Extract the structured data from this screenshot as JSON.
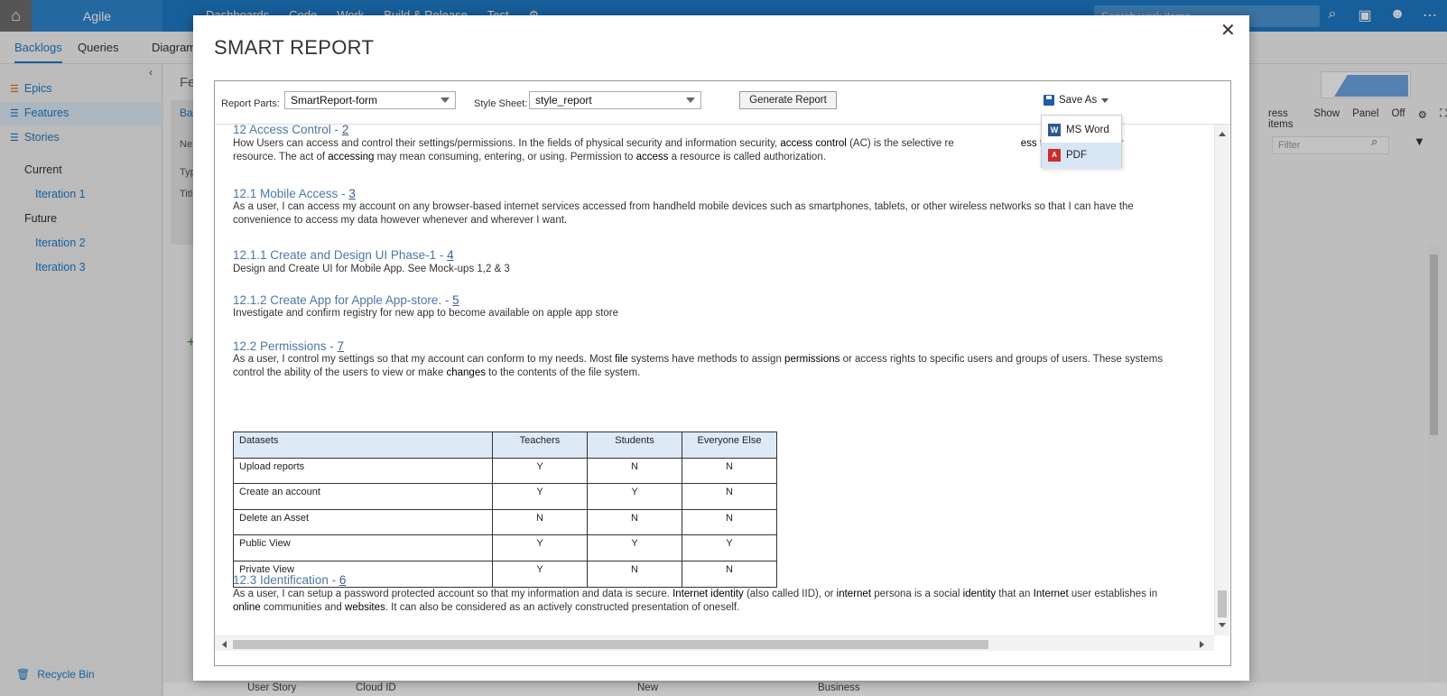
{
  "app": {
    "project": "Agile",
    "hubs": [
      "Dashboards",
      "Code",
      "Work",
      "Build & Release",
      "Test"
    ],
    "search_placeholder": "Search work items",
    "subtabs": [
      "Backlogs",
      "Queries",
      "Diagram"
    ],
    "left_nav": {
      "backlogs": [
        "Epics",
        "Features",
        "Stories"
      ],
      "current_label": "Current",
      "current_iterations": [
        "Iteration 1"
      ],
      "future_label": "Future",
      "future_iterations": [
        "Iteration 2",
        "Iteration 3"
      ],
      "recycle_bin": "Recycle Bin"
    },
    "right_panel": {
      "progress_items": "ress items",
      "show": "Show",
      "panel": "Panel",
      "off": "Off",
      "filter_placeholder": "Filter"
    },
    "bottom_row": {
      "type": "User Story",
      "title": "Cloud ID",
      "state": "New",
      "area": "Business"
    },
    "background_fragments": {
      "main_header": "Fe",
      "tab": "Bac",
      "new": "Ne",
      "type": "Typ",
      "title": "Titl"
    }
  },
  "modal": {
    "title": "SMART REPORT",
    "close_glyph": "✕",
    "toolbar": {
      "report_parts_label": "Report Parts:",
      "report_parts_value": "SmartReport-form",
      "style_sheet_label": "Style Sheet:",
      "style_sheet_value": "style_report",
      "generate_label": "Generate Report",
      "save_as_label": "Save As"
    },
    "save_menu": [
      {
        "label": "MS Word",
        "icon": "word-icon"
      },
      {
        "label": "PDF",
        "icon": "pdf-icon"
      }
    ],
    "sections": [
      {
        "heading": "12 Access Control - ",
        "num": "2",
        "body_parts": [
          "How Users can access and control their settings/permissions. In the fields of physical security and information security, ",
          "access control",
          " (AC) is the selective re",
          "ess",
          " to a place or other resource. The act of ",
          "accessing",
          " may mean consuming, entering, or using. Permission to ",
          "access",
          " a resource is called authorization."
        ]
      },
      {
        "heading": "12.1 Mobile Access - ",
        "num": "3",
        "body": "As a user, I can access my account on any browser-based internet services accessed from handheld mobile devices such as smartphones, tablets, or other wireless networks so that I can have the convenience to access my data however whenever and wherever I want."
      },
      {
        "heading": "12.1.1 Create and Design UI Phase-1 - ",
        "num": "4",
        "body": "Design and Create UI for Mobile App. See Mock-ups 1,2 & 3"
      },
      {
        "heading": "12.1.2 Create App for Apple App-store. - ",
        "num": "5",
        "body": "Investigate and confirm registry for new app to become available on apple app store"
      },
      {
        "heading": "12.2 Permissions - ",
        "num": "7",
        "body_parts": [
          "As a user, I control my settings so that my account can conform to my needs. Most ",
          "file",
          " systems have methods to assign ",
          "permissions",
          " or access rights to specific users and groups of users. These systems control the ability of the users to view or make ",
          "changes",
          " to the contents of the file system."
        ]
      },
      {
        "heading": "12.3 Identification - ",
        "num": "6",
        "body_parts": [
          "As a user, I can setup a password protected account so that my information and data is secure. ",
          "Internet identity",
          " (also called IID), or ",
          "internet",
          " persona is a social ",
          "identity",
          " that an ",
          "Internet",
          " user establishes in ",
          "online",
          " communities and ",
          "websites",
          ". It can also be considered as an actively constructed presentation of oneself."
        ]
      }
    ],
    "table": {
      "headers": [
        "Datasets",
        "Teachers",
        "Students",
        "Everyone Else"
      ],
      "rows": [
        [
          "Upload reports",
          "Y",
          "N",
          "N"
        ],
        [
          "Create an account",
          "Y",
          "Y",
          "N"
        ],
        [
          "Delete an Asset",
          "N",
          "N",
          "N"
        ],
        [
          "Public View",
          "Y",
          "Y",
          "Y"
        ],
        [
          "Private View",
          "Y",
          "N",
          "N"
        ]
      ]
    }
  },
  "colors": {
    "topbar": "#1e7ac6",
    "link": "#4a78a8",
    "table_header": "#dde9f5",
    "menu_hover": "#d6e6f5"
  }
}
